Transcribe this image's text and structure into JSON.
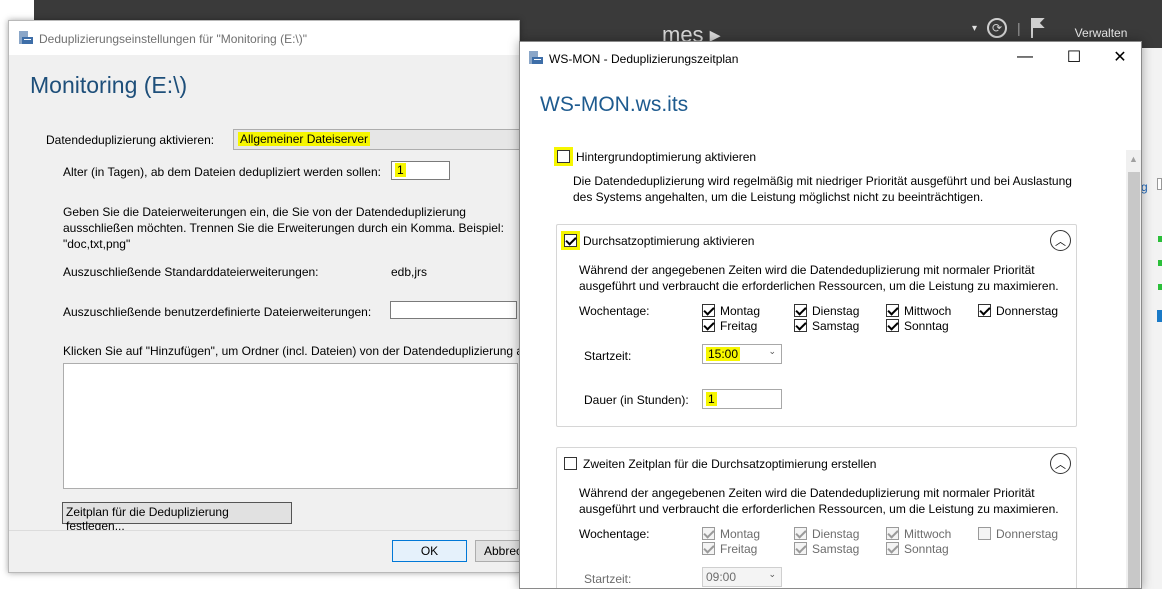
{
  "background": {
    "crumb_tail": "mes ▸",
    "manage_label": "Verwalten",
    "right_link": "g"
  },
  "dialog1": {
    "title": "Deduplizierungseinstellungen für \"Monitoring (E:\\)\"",
    "heading": "Monitoring (E:\\)",
    "dedup_label": "Datendeduplizierung aktivieren:",
    "dedup_value": "Allgemeiner Dateiserver",
    "age_label": "Alter (in Tagen), ab dem Dateien dedupliziert werden sollen:",
    "age_value": "1",
    "ext_description": "Geben Sie die Dateierweiterungen ein, die Sie von der Datendeduplizierung ausschließen möchten. Trennen Sie die Erweiterungen durch ein Komma. Beispiel: \"doc,txt,png\"",
    "std_ext_label": "Auszuschließende Standarddateierweiterungen:",
    "std_ext_value": "edb,jrs",
    "custom_ext_label": "Auszuschließende benutzerdefinierte Dateierweiterungen:",
    "custom_ext_value": "",
    "folders_hint": "Klicken Sie auf \"Hinzufügen\", um Ordner (incl. Dateien) von der Datendeduplizierung a",
    "schedule_button": "Zeitplan für die Deduplizierung festlegen...",
    "ok_button": "OK",
    "cancel_button": "Abbrec"
  },
  "dialog2": {
    "title": "WS-MON - Deduplizierungszeitplan",
    "heading": "WS-MON.ws.its",
    "bg_opt_label": "Hintergrundoptimierung aktivieren",
    "bg_opt_checked": false,
    "bg_opt_desc": "Die Datendeduplizierung wird regelmäßig mit niedriger Priorität ausgeführt und bei Auslastung des Systems angehalten, um die Leistung möglichst nicht zu beeinträchtigen.",
    "throughput": {
      "label": "Durchsatzoptimierung aktivieren",
      "checked": true,
      "desc": "Während der angegebenen Zeiten wird die Datendeduplizierung mit normaler Priorität ausgeführt und verbraucht die erforderlichen Ressourcen, um die Leistung zu maximieren.",
      "weekdays_label": "Wochentage:",
      "days": [
        {
          "name": "Montag",
          "checked": true
        },
        {
          "name": "Dienstag",
          "checked": true
        },
        {
          "name": "Mittwoch",
          "checked": true
        },
        {
          "name": "Donnerstag",
          "checked": true
        },
        {
          "name": "Freitag",
          "checked": true
        },
        {
          "name": "Samstag",
          "checked": true
        },
        {
          "name": "Sonntag",
          "checked": true
        }
      ],
      "start_label": "Startzeit:",
      "start_value": "15:00",
      "duration_label": "Dauer (in Stunden):",
      "duration_value": "1"
    },
    "second": {
      "label": "Zweiten Zeitplan für die Durchsatzoptimierung erstellen",
      "checked": false,
      "desc": "Während der angegebenen Zeiten wird die Datendeduplizierung mit normaler Priorität ausgeführt und verbraucht die erforderlichen Ressourcen, um die Leistung zu maximieren.",
      "weekdays_label": "Wochentage:",
      "days": [
        {
          "name": "Montag",
          "checked": true
        },
        {
          "name": "Dienstag",
          "checked": true
        },
        {
          "name": "Mittwoch",
          "checked": true
        },
        {
          "name": "Donnerstag",
          "checked": false
        },
        {
          "name": "Freitag",
          "checked": true
        },
        {
          "name": "Samstag",
          "checked": true
        },
        {
          "name": "Sonntag",
          "checked": true
        }
      ],
      "start_label": "Startzeit:",
      "start_value": "09:00"
    }
  },
  "colors": {
    "highlight": "#f6f600",
    "heading_blue": "#1e5b8f",
    "topbar": "#3a3a3a"
  },
  "icons": {
    "window_icon": "dedup-volume-icon",
    "collapse": "chevron-up-icon",
    "dropdown": "chevron-down-icon"
  }
}
